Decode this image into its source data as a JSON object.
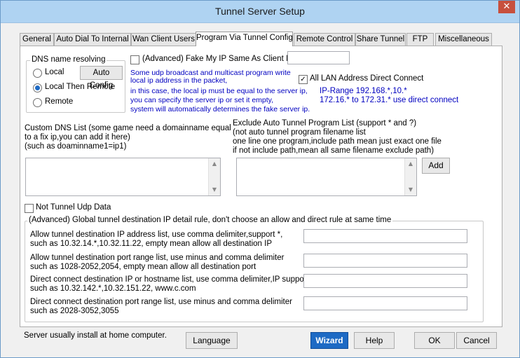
{
  "window": {
    "title": "Tunnel Server Setup",
    "close_glyph": "✕"
  },
  "tabs": [
    {
      "label": "General"
    },
    {
      "label": "Auto Dial To Internal"
    },
    {
      "label": "Wan Client Users"
    },
    {
      "label": "Program Via Tunnel Config"
    },
    {
      "label": "Remote Control"
    },
    {
      "label": "Share Tunnel"
    },
    {
      "label": "FTP"
    },
    {
      "label": "Miscellaneous"
    }
  ],
  "active_tab": "Program Via Tunnel Config",
  "dns": {
    "group_title": "DNS name resolving",
    "options": [
      "Local",
      "Local Then Remote",
      "Remote"
    ],
    "selected": "Local Then Remote",
    "auto_config_label": "Auto Config"
  },
  "fake_ip": {
    "label": "(Advanced) Fake My IP Same As Client IP:",
    "checked": false,
    "value": "",
    "info": [
      "Some udp broadcast and multicast program write",
      "local ip address in the packet,",
      "in this case, the local ip must be equal to the server ip,",
      "you can specify the server ip or set it empty,",
      "system will automatically determines the fake server ip."
    ]
  },
  "lan_direct": {
    "label": "All LAN Address Direct Connect",
    "checked": true,
    "info": [
      "IP-Range 192.168.*,10.*",
      "172.16.* to 172.31.* use direct connect"
    ]
  },
  "custom_dns": {
    "label": [
      "Custom DNS List (some game need a domainname equal",
      " to a fix ip,you can add it here)",
      "(such as  doaminname1=ip1)"
    ],
    "value": ""
  },
  "exclude": {
    "label": [
      "Exclude Auto Tunnel Program List (support * and ?)",
      "(not auto tunnel program filename list",
      "one line one program,include path mean just exact one file",
      "if not include path,mean all same filename exclude path)"
    ],
    "value": "",
    "add_label": "Add"
  },
  "not_tunnel_udp": {
    "label": "Not Tunnel Udp Data",
    "checked": false
  },
  "global_rule": {
    "group_title": "(Advanced) Global tunnel destination IP detail rule, don't choose an allow and direct rule at same time",
    "rows": [
      {
        "line1": "Allow tunnel destination IP address list, use comma delimiter,support *,",
        "line2": "such as 10.32.14.*,10.32.11.22, empty mean allow all destination IP",
        "value": ""
      },
      {
        "line1": "Allow tunnel destination port range list, use minus and comma delimiter",
        "line2": "such as 1028-2052,2054, empty mean allow all destination port",
        "value": ""
      },
      {
        "line1": "Direct connect destination IP or hostname list, use comma delimiter,IP support *",
        "line2": "such as 10.32.142.*,10.32.151.22, www.c.com",
        "value": ""
      },
      {
        "line1": "Direct connect destination port range list, use minus and comma delimiter",
        "line2": "such as 2028-3052,3055",
        "value": ""
      }
    ]
  },
  "footer": {
    "note": "Server usually install at home computer.",
    "language_label": "Language",
    "wizard_label": "Wizard",
    "help_label": "Help",
    "ok_label": "OK",
    "cancel_label": "Cancel"
  },
  "colors": {
    "accent": "#1e6ac4",
    "info_text": "#0000c0",
    "titlebar": "#afd3f2",
    "close": "#c7503e"
  }
}
